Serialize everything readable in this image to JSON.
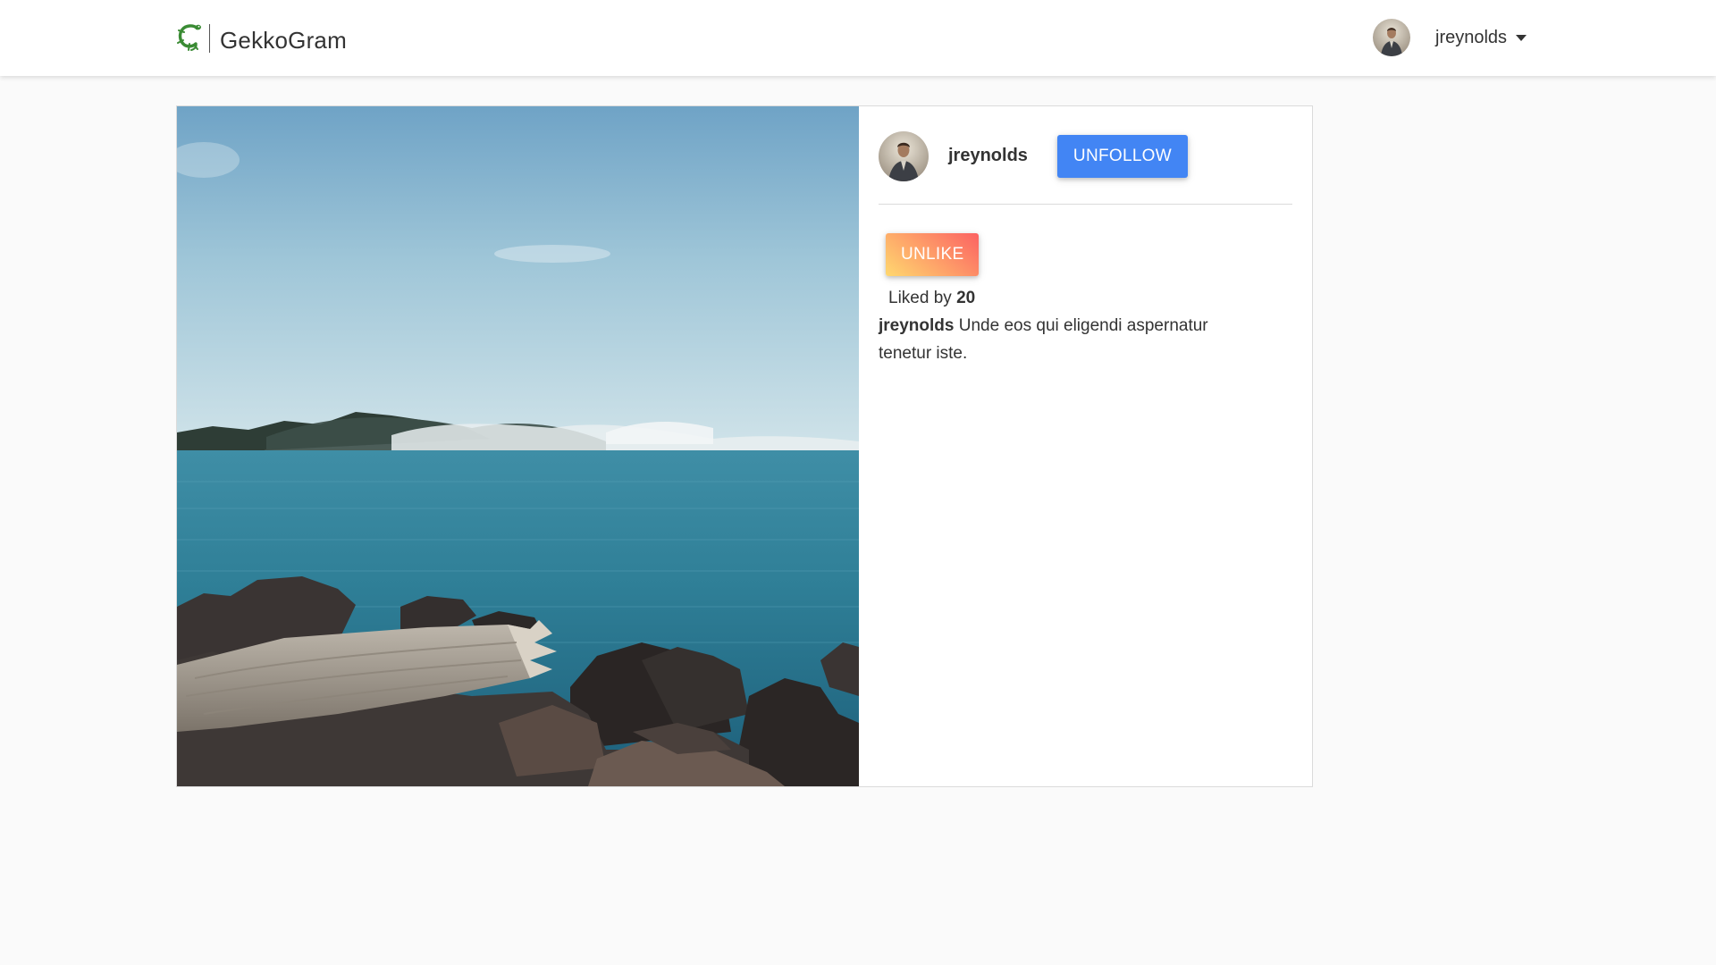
{
  "navbar": {
    "brand_name": "GekkoGram",
    "brand_logo_icon": "gecko-icon",
    "username": "jreynolds",
    "dropdown_icon": "caret-down-icon"
  },
  "post": {
    "username": "jreynolds",
    "follow_button_label": "UNFOLLOW",
    "like_button_label": "UNLIKE",
    "liked_by_label": "Liked by",
    "likes_count": "20",
    "caption_username": "jreynolds",
    "caption_text": "Unde eos qui eligendi aspernatur tenetur iste."
  },
  "colors": {
    "follow_button": "#4285f4",
    "like_gradient_start": "#ffd86f",
    "like_gradient_end": "#fc6262",
    "page_background": "#fafafa",
    "brand_green": "#3a8b34"
  }
}
